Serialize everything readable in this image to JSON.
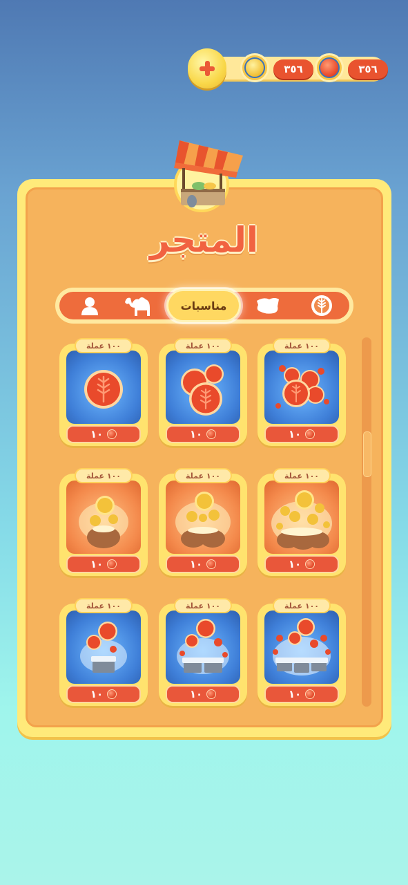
{
  "currency": {
    "add_icon": "plus-icon",
    "gold_icon": "gold-coin-icon",
    "gold_amount": "٣٥٦",
    "red_icon": "red-coin-icon",
    "red_amount": "٣٥٦"
  },
  "shop": {
    "title": "المتجر",
    "stall_icon": "market-stall-icon",
    "tabs": [
      {
        "icon": "wheat-coin-icon",
        "label": ""
      },
      {
        "icon": "map-icon",
        "label": ""
      },
      {
        "label": "مناسبات",
        "active": true
      },
      {
        "icon": "camel-icon",
        "label": ""
      },
      {
        "icon": "profile-icon",
        "label": ""
      }
    ],
    "items": [
      {
        "tag": "١٠٠ عملة",
        "price": "١٠",
        "art": "red-coin-single"
      },
      {
        "tag": "١٠٠ عملة",
        "price": "١٠",
        "art": "red-coin-few"
      },
      {
        "tag": "١٠٠ عملة",
        "price": "١٠",
        "art": "red-coin-pile"
      },
      {
        "tag": "١٠٠ عملة",
        "price": "١٠",
        "art": "gold-coin-bag-small"
      },
      {
        "tag": "١٠٠ عملة",
        "price": "١٠",
        "art": "gold-coin-bag-medium"
      },
      {
        "tag": "١٠٠ عملة",
        "price": "١٠",
        "art": "gold-coin-bag-large"
      },
      {
        "tag": "١٠٠ عملة",
        "price": "١٠",
        "art": "red-coin-chest-small"
      },
      {
        "tag": "١٠٠ عملة",
        "price": "١٠",
        "art": "red-coin-chest-medium"
      },
      {
        "tag": "١٠٠ عملة",
        "price": "١٠",
        "art": "red-coin-chest-large"
      }
    ]
  },
  "colors": {
    "panel": "#f6b35c",
    "accent": "#ee6c3c",
    "gold": "#ffe36e"
  }
}
